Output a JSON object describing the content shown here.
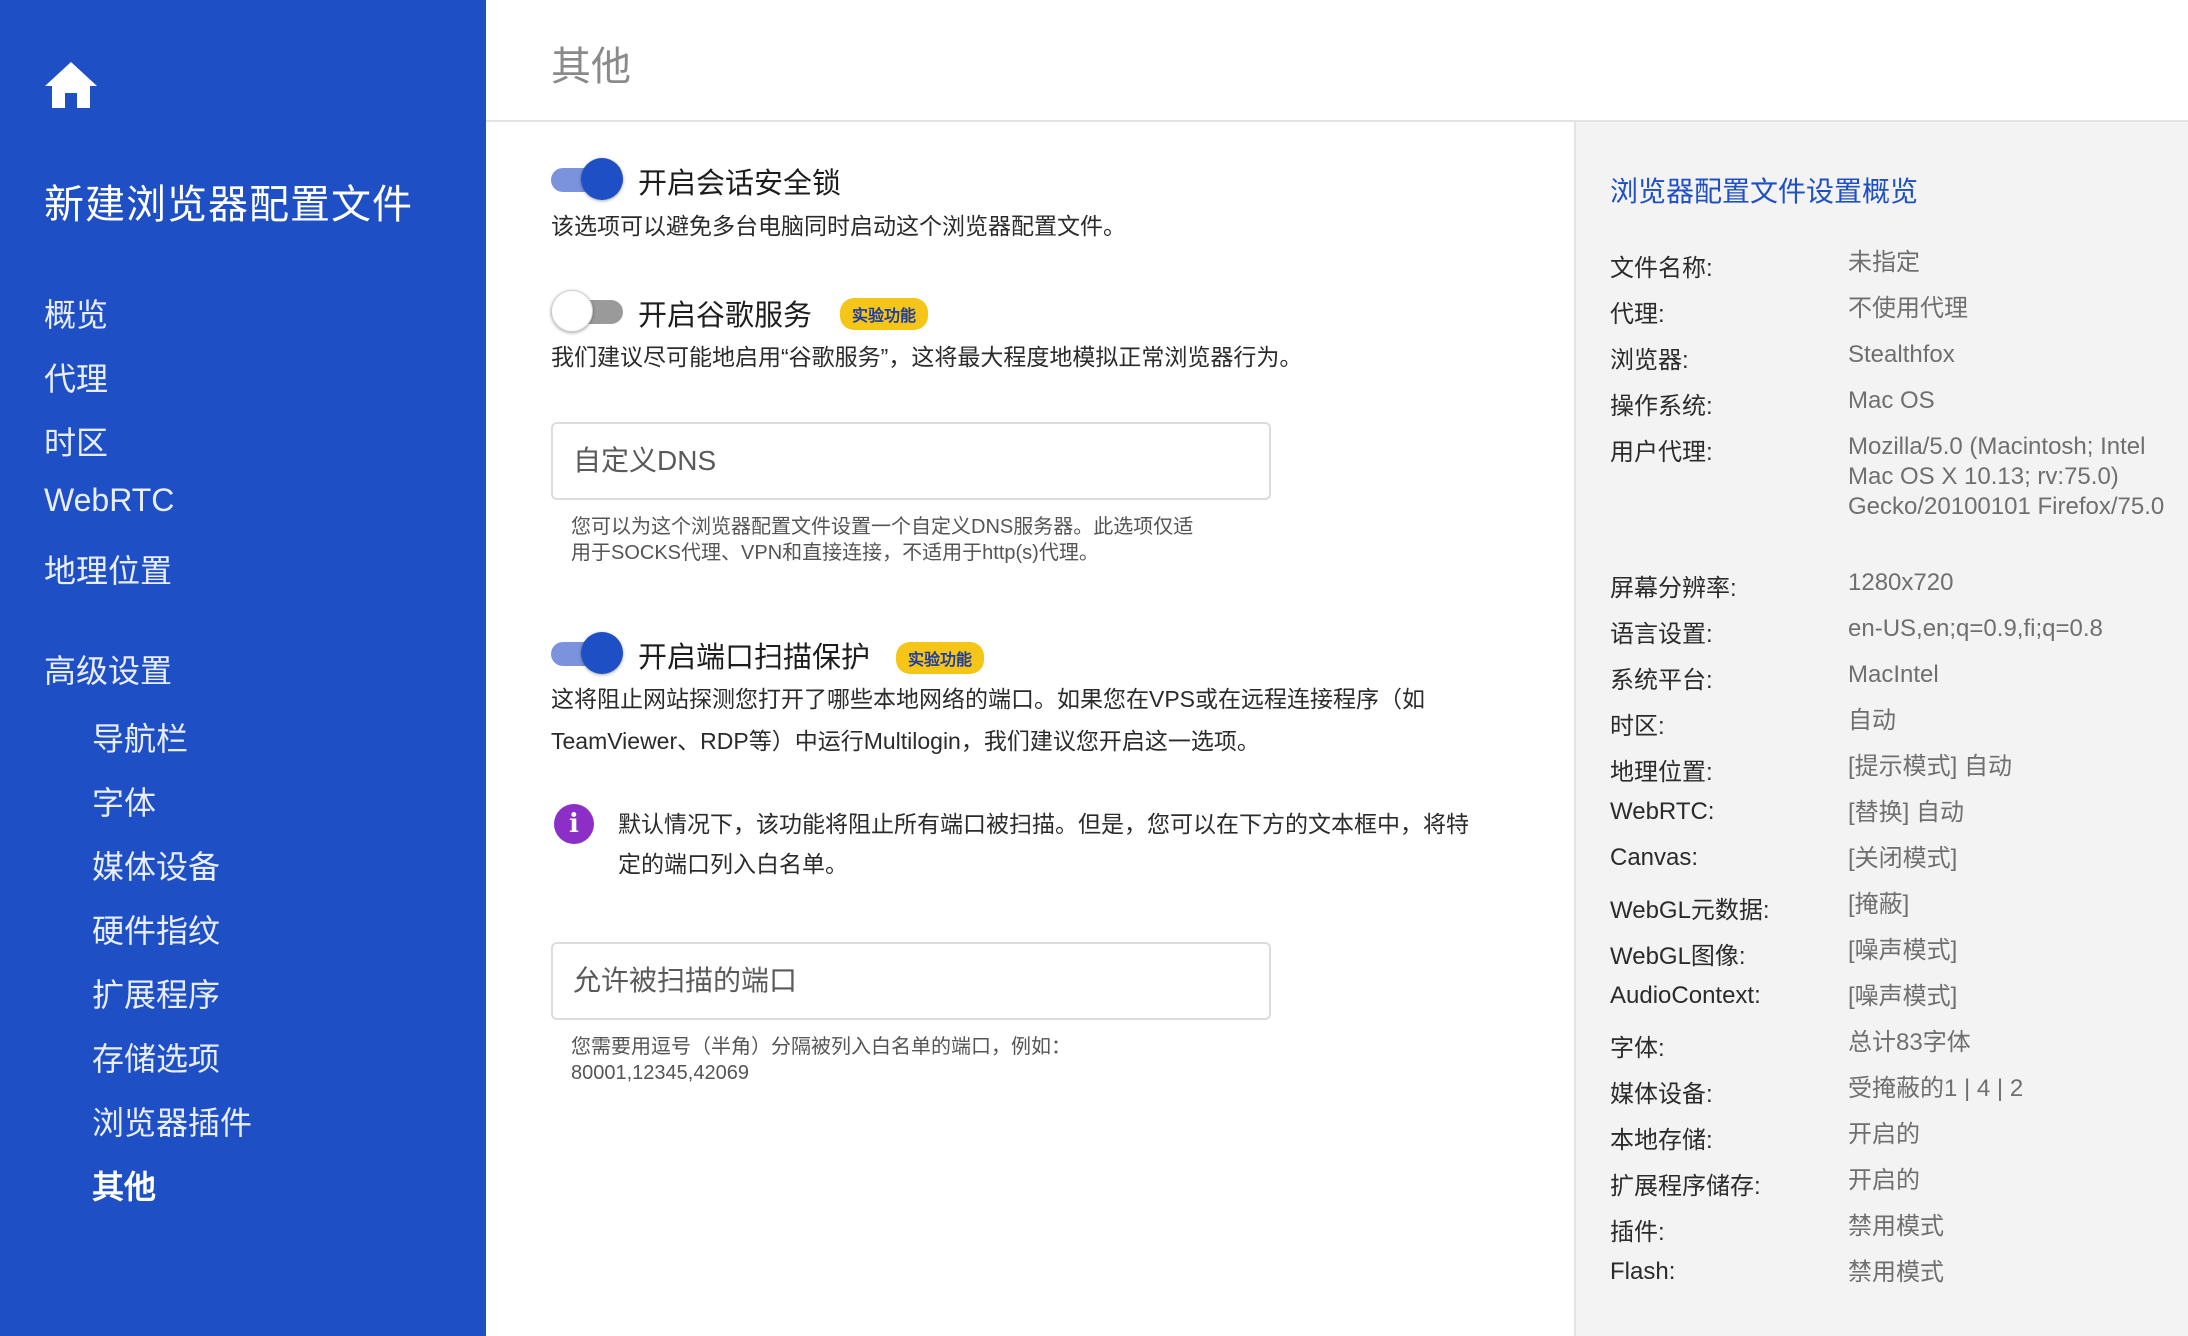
{
  "sidebar": {
    "title": "新建浏览器配置文件",
    "items": [
      "概览",
      "代理",
      "时区",
      "WebRTC",
      "地理位置"
    ],
    "advanced_title": "高级设置",
    "sub_items": [
      "导航栏",
      "字体",
      "媒体设备",
      "硬件指纹",
      "扩展程序",
      "存储选项",
      "浏览器插件",
      "其他"
    ],
    "active_item": "其他",
    "color": "#1f4fc5"
  },
  "header": {
    "title": "其他"
  },
  "main": {
    "session_lock": {
      "label": "开启会话安全锁",
      "desc": "该选项可以避免多台电脑同时启动这个浏览器配置文件。",
      "enabled": true
    },
    "google_services": {
      "label": "开启谷歌服务",
      "badge": "实验功能",
      "desc": "我们建议尽可能地启用“谷歌服务”，这将最大程度地模拟正常浏览器行为。",
      "enabled": false
    },
    "dns": {
      "placeholder": "自定义DNS",
      "hint_line1": "您可以为这个浏览器配置文件设置一个自定义DNS服务器。此选项仅适",
      "hint_line2": "用于SOCKS代理、VPN和直接连接，不适用于http(s)代理。"
    },
    "port_scan": {
      "label": "开启端口扫描保护",
      "badge": "实验功能",
      "desc_line1": "这将阻止网站探测您打开了哪些本地网络的端口。如果您在VPS或在远程连接程序（如",
      "desc_line2": "TeamViewer、RDP等）中运行Multilogin，我们建议您开启这一选项。",
      "enabled": true
    },
    "info": {
      "icon": "info-icon",
      "line1": "默认情况下，该功能将阻止所有端口被扫描。但是，您可以在下方的文本框中，将特",
      "line2": "定的端口列入白名单。"
    },
    "ports": {
      "placeholder": "允许被扫描的端口",
      "hint_line1": "您需要用逗号（半角）分隔被列入白名单的端口，例如：",
      "hint_line2": "80001,12345,42069"
    }
  },
  "summary": {
    "title": "浏览器配置文件设置概览",
    "rows": [
      {
        "key": "文件名称:",
        "value": "未指定"
      },
      {
        "key": "代理:",
        "value": "不使用代理"
      },
      {
        "key": "浏览器:",
        "value": "Stealthfox"
      },
      {
        "key": "操作系统:",
        "value": "Mac OS"
      },
      {
        "key": "用户代理:",
        "value": "Mozilla/5.0 (Macintosh; Intel Mac OS X 10.13; rv:75.0) Gecko/20100101 Firefox/75.0"
      },
      {
        "key": "屏幕分辨率:",
        "value": "1280x720"
      },
      {
        "key": "语言设置:",
        "value": "en-US,en;q=0.9,fi;q=0.8"
      },
      {
        "key": "系统平台:",
        "value": "MacIntel"
      },
      {
        "key": "时区:",
        "value": "自动"
      },
      {
        "key": "地理位置:",
        "value": "[提示模式] 自动"
      },
      {
        "key": "WebRTC:",
        "value": "[替换] 自动"
      },
      {
        "key": "Canvas:",
        "value": "[关闭模式]"
      },
      {
        "key": "WebGL元数据:",
        "value": "[掩蔽]"
      },
      {
        "key": "WebGL图像:",
        "value": "[噪声模式]"
      },
      {
        "key": "AudioContext:",
        "value": "[噪声模式]"
      },
      {
        "key": "字体:",
        "value": "总计83字体"
      },
      {
        "key": "媒体设备:",
        "value": "受掩蔽的1 | 4 | 2"
      },
      {
        "key": "本地存储:",
        "value": "开启的"
      },
      {
        "key": "扩展程序储存:",
        "value": "开启的"
      },
      {
        "key": "插件:",
        "value": "禁用模式"
      },
      {
        "key": "Flash:",
        "value": "禁用模式"
      }
    ]
  }
}
